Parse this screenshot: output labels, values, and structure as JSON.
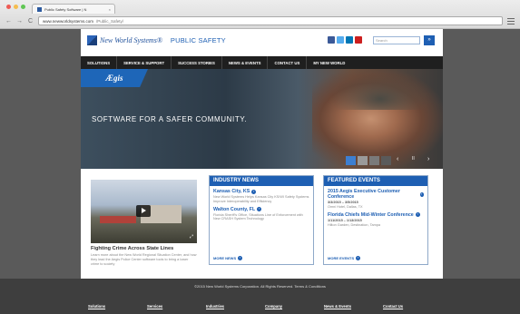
{
  "browser": {
    "tab_title": "Public Safety Software | N",
    "tab_close": "×",
    "url_domain": "www.newworldsystems.com",
    "url_path": "/Public_Safety/",
    "back": "←",
    "forward": "→",
    "reload": "C"
  },
  "header": {
    "brand": "New World Systems",
    "brand_suffix": "®",
    "tagline": "PUBLIC SAFETY",
    "search_placeholder": "Search",
    "search_button": "»",
    "social_colors": [
      "#3b5998",
      "#55acee",
      "#0077b5",
      "#cc1f1f"
    ]
  },
  "nav": {
    "items": [
      "SOLUTIONS",
      "SERVICE & SUPPORT",
      "SUCCESS STORIES",
      "NEWS & EVENTS",
      "CONTACT US",
      "MY NEW WORLD"
    ]
  },
  "hero": {
    "aegis": "Ægis",
    "tagline": "SOFTWARE FOR A SAFER COMMUNITY.",
    "prev": "‹",
    "pause": "II",
    "next": "›",
    "slide_colors": [
      "#3d7fd1",
      "#9a9a9a",
      "#7a7a7a",
      "#5a5a5a"
    ]
  },
  "story": {
    "title": "Fighting Crime Across State Lines",
    "text": "Learn more about the New World Regional Situation Center, and how they lead the Aegis Police Center software tools to bring a lower crime to society"
  },
  "news": {
    "heading": "INDUSTRY NEWS",
    "items": [
      {
        "title": "Kansas City, KS",
        "text": "New World Systems Helps Kansas City KS/WI Safety Systems Improve Interoperability and Efficiency"
      },
      {
        "title": "Walton County, FL",
        "text": "Florida Sheriff's Office, Situations Line of Enforcement with New CRASH System Technology"
      }
    ],
    "more": "MORE NEWS"
  },
  "events": {
    "heading": "FEATURED EVENTS",
    "items": [
      {
        "title": "2015 Aegis Executive Customer Conference",
        "date": "3/3/2015 – 3/5/2015",
        "text": "Omni Hotel, Dallas, TX"
      },
      {
        "title": "Florida Chiefs Mid-Winter Conference",
        "date": "1/11/2015 – 1/13/2015",
        "text": "Hilton Garden, Destination, Tampa"
      }
    ],
    "more": "MORE EVENTS"
  },
  "footer": {
    "copyright": "©2015 New World Systems Corporation. All Rights Reserved. Terms & Conditions",
    "links": [
      "Solutions",
      "Services",
      "Industries",
      "Company",
      "News & Events",
      "Contact Us"
    ]
  }
}
